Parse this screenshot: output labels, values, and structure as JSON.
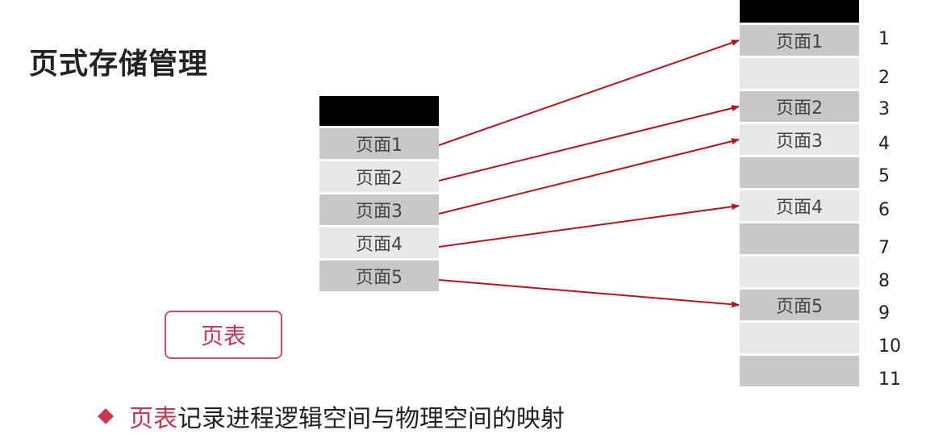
{
  "title": "页式存储管理",
  "page_table": {
    "label": "页表",
    "rows": [
      "页面1",
      "页面2",
      "页面3",
      "页面4",
      "页面5"
    ]
  },
  "memory": {
    "slots": [
      {
        "index": "1",
        "label": "页面1"
      },
      {
        "index": "2",
        "label": ""
      },
      {
        "index": "3",
        "label": "页面2"
      },
      {
        "index": "4",
        "label": "页面3"
      },
      {
        "index": "5",
        "label": ""
      },
      {
        "index": "6",
        "label": "页面4"
      },
      {
        "index": "7",
        "label": ""
      },
      {
        "index": "8",
        "label": ""
      },
      {
        "index": "9",
        "label": "页面5"
      },
      {
        "index": "10",
        "label": ""
      },
      {
        "index": "11",
        "label": ""
      }
    ]
  },
  "mappings": [
    {
      "from": 0,
      "to": 0
    },
    {
      "from": 1,
      "to": 2
    },
    {
      "from": 2,
      "to": 3
    },
    {
      "from": 3,
      "to": 5
    },
    {
      "from": 4,
      "to": 8
    }
  ],
  "bullet": {
    "highlight": "页表",
    "rest": "记录进程逻辑空间与物理空间的映射"
  },
  "colors": {
    "arrow": "#b81420",
    "accent": "#c8364f"
  }
}
